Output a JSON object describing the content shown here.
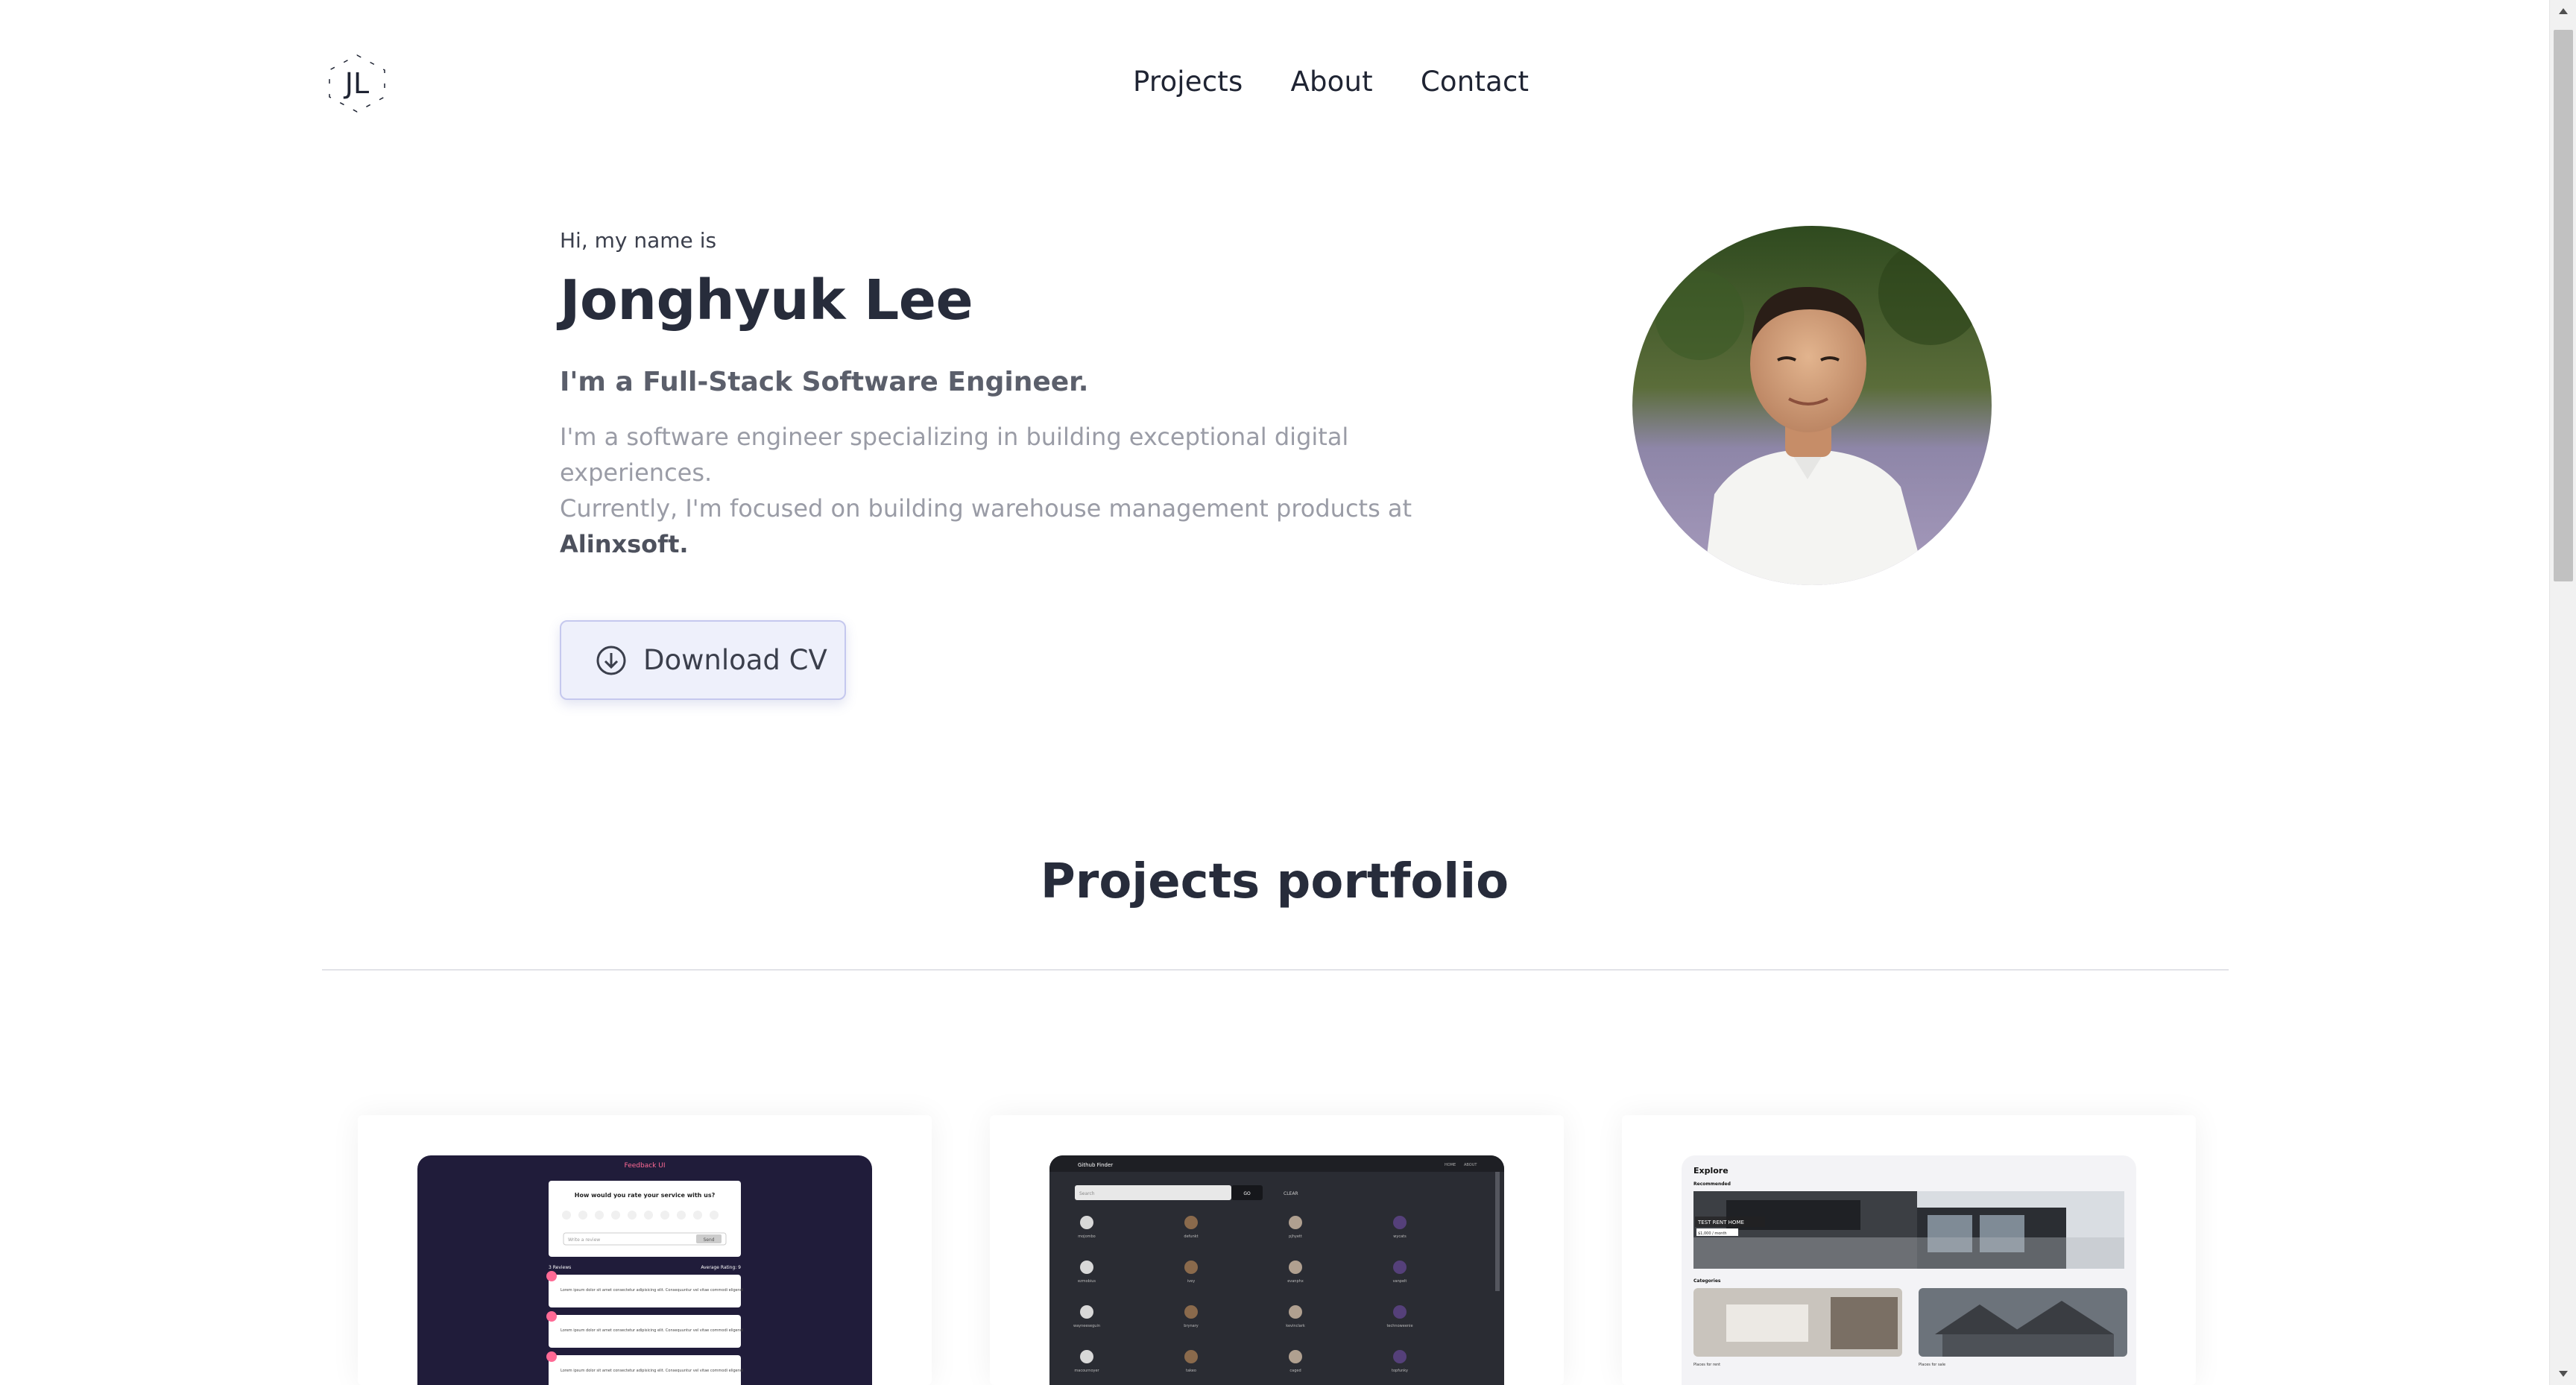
{
  "header": {
    "logo_text": "JL",
    "nav": [
      "Projects",
      "About",
      "Contact"
    ]
  },
  "hero": {
    "intro": "Hi, my name is",
    "name": "Jonghyuk Lee",
    "role": "I'm a Full-Stack Software Engineer.",
    "description_line1": "I'm a software engineer specializing in building exceptional digital experiences.",
    "description_line2": "Currently, I'm focused on building warehouse management products at",
    "company": "Alinxsoft.",
    "cv_button": "Download CV"
  },
  "projects": {
    "title": "Projects portfolio",
    "cards": [
      {
        "app_title": "Feedback UI",
        "question": "How would you rate your service with us?",
        "ratings": [
          "1",
          "2",
          "3",
          "4",
          "5",
          "6",
          "7",
          "8",
          "9",
          "10"
        ],
        "input_placeholder": "Write a review",
        "send": "Send",
        "reviews_count": "3 Reviews",
        "average": "Average Rating: 9",
        "review_text": "Lorem ipsum dolor sit amet consectetur adipisicing elit. Consequuntur vel vitae commodi eligendi"
      },
      {
        "app_title": "Github Finder",
        "nav_home": "HOME",
        "nav_about": "ABOUT",
        "search_placeholder": "Search",
        "go": "GO",
        "clear": "CLEAR",
        "users": [
          "mojombo",
          "defunkt",
          "pjhyett",
          "wycats",
          "ezmobius",
          "ivey",
          "evanphx",
          "vanpelt",
          "wayneeseguin",
          "brynary",
          "kevinclark",
          "technoweenie",
          "macournoyer",
          "takeo",
          "caged",
          "topfunky"
        ]
      },
      {
        "app_title": "Explore",
        "recommended": "Recommended",
        "featured_label": "TEST RENT HOME",
        "featured_price": "$1,000 / month",
        "categories": "Categories",
        "cat1": "Places for rent",
        "cat2": "Places for sale"
      }
    ]
  },
  "colors": {
    "accent_button_bg": "#eef0fb",
    "accent_button_border": "#c5c8ee",
    "card1_bg": "#201c3a",
    "card2_bg": "#2a2c33",
    "heading": "#272c3b"
  }
}
